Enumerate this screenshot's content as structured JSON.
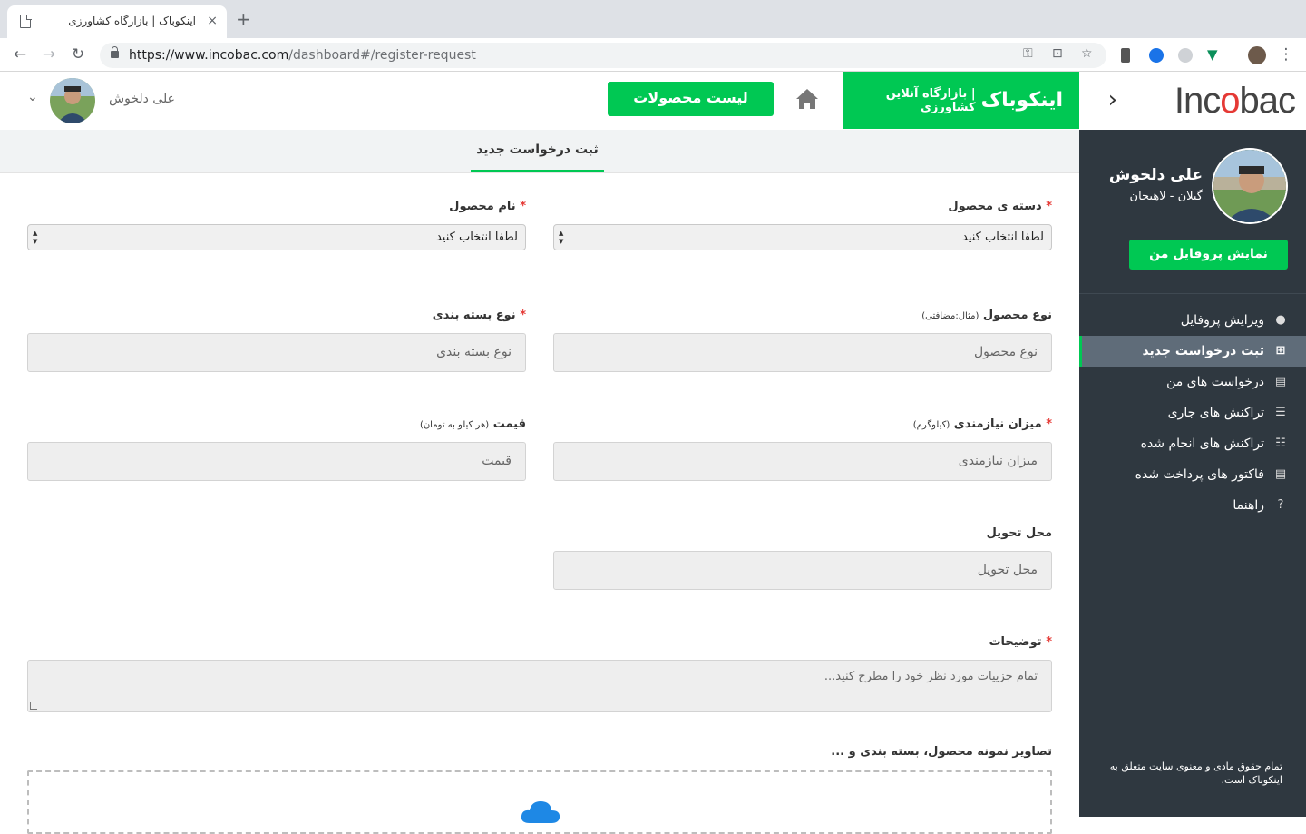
{
  "browser": {
    "tab_title": "اینکوباک | بازارگاه کشاورزی",
    "tab_close": "×",
    "new_tab": "+",
    "url_host": "https://www.incobac.com",
    "url_path": "/dashboard#/register-request"
  },
  "header": {
    "logo_pre": "Inc",
    "logo_o": "o",
    "logo_post": "bac",
    "sidebar_toggle": "›",
    "brand_name": "اینکوباک",
    "brand_sub": "| بازارگاه آنلاین کشاورزی",
    "products_button": "لیست محصولات",
    "user_name": "علی دلخوش",
    "dropdown_chevron": "⌄"
  },
  "sidebar": {
    "name": "علی دلخوش",
    "location": "گیلان - لاهیجان",
    "profile_button": "نمایش پروفایل من",
    "items": [
      {
        "label": "ویرایش پروفایل",
        "icon": "user-icon",
        "glyph": "●"
      },
      {
        "label": "ثبت درخواست جدید",
        "icon": "plus-square-icon",
        "glyph": "⊞"
      },
      {
        "label": "درخواست های من",
        "icon": "list-alt-icon",
        "glyph": "▤"
      },
      {
        "label": "تراکنش های جاری",
        "icon": "list-icon",
        "glyph": "☰"
      },
      {
        "label": "تراکنش های انجام شده",
        "icon": "th-list-icon",
        "glyph": "☷"
      },
      {
        "label": "فاکتور های پرداخت شده",
        "icon": "list-alt-icon",
        "glyph": "▤"
      },
      {
        "label": "راهنما",
        "icon": "question-circle-icon",
        "glyph": "?"
      }
    ],
    "active_index": 1,
    "footer": "تمام حقوق مادی و معنوی سایت متعلق به اینکوباک است."
  },
  "page": {
    "tab": "ثبت درخواست جدید"
  },
  "form": {
    "category": {
      "label": "دسته ی محصول",
      "value": "لطفا انتخاب کنید"
    },
    "product_name": {
      "label": "نام محصول",
      "value": "لطفا انتخاب کنید"
    },
    "product_type": {
      "label": "نوع محصول",
      "hint": "(مثال:مضافتی)",
      "placeholder": "نوع محصول"
    },
    "packaging": {
      "label": "نوع بسته بندی",
      "placeholder": "نوع بسته بندی"
    },
    "quantity": {
      "label": "میزان نیازمندی",
      "hint": "(کیلوگرم)",
      "placeholder": "میزان نیازمندی"
    },
    "price": {
      "label": "قیمت",
      "hint": "(هر کیلو به تومان)",
      "placeholder": "قیمت"
    },
    "delivery": {
      "label": "محل تحویل",
      "placeholder": "محل تحویل"
    },
    "description": {
      "label": "توضیحات",
      "placeholder": "تمام جزییات مورد نظر خود را مطرح کنید..."
    },
    "images": {
      "label": "تصاویر نمونه محصول، بسته بندی و ..."
    },
    "required_mark": "*"
  },
  "colors": {
    "accent": "#00c853",
    "sidebar_bg": "#2f3840",
    "required": "#e53935"
  }
}
